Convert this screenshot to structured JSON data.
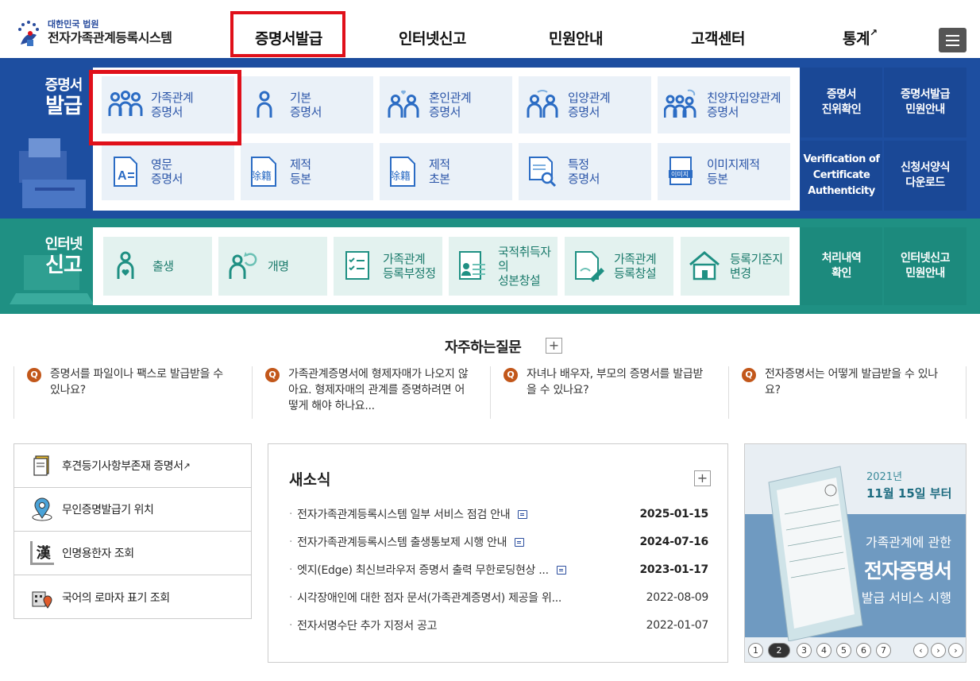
{
  "header": {
    "logo_line1": "대한민국 법원",
    "logo_line2": "전자가족관계등록시스템",
    "nav": [
      "증명서발급",
      "인터넷신고",
      "민원안내",
      "고객센터",
      "통계"
    ],
    "menu_icon": "hamburger-icon"
  },
  "cert": {
    "title_small": "증명서",
    "title_big": "발급",
    "tiles": [
      {
        "l1": "가족관계",
        "l2": "증명서",
        "icon": "family-icon"
      },
      {
        "l1": "기본",
        "l2": "증명서",
        "icon": "person-icon"
      },
      {
        "l1": "혼인관계",
        "l2": "증명서",
        "icon": "couple-heart-icon"
      },
      {
        "l1": "입양관계",
        "l2": "증명서",
        "icon": "adoption-icon"
      },
      {
        "l1": "친양자입양관계",
        "l2": "증명서",
        "icon": "full-adoption-icon"
      },
      {
        "l1": "영문",
        "l2": "증명서",
        "icon": "english-doc-icon"
      },
      {
        "l1": "제적",
        "l2": "등본",
        "icon": "removed-register-icon"
      },
      {
        "l1": "제적",
        "l2": "초본",
        "icon": "removed-register-icon"
      },
      {
        "l1": "특정",
        "l2": "증명서",
        "icon": "search-doc-icon"
      },
      {
        "l1": "이미지제적",
        "l2": "등본",
        "icon": "image-doc-icon"
      }
    ],
    "side": [
      {
        "l1": "증명서",
        "l2": "진위확인"
      },
      {
        "l1": "증명서발급",
        "l2": "민원안내"
      },
      {
        "l1": "Verification of",
        "l2": "Certificate",
        "l3": "Authenticity"
      },
      {
        "l1": "신청서양식",
        "l2": "다운로드"
      }
    ],
    "removed_badge": "除籍",
    "image_badge": "이미지"
  },
  "report": {
    "title_small": "인터넷",
    "title_big": "신고",
    "tiles": [
      {
        "l1": "출생",
        "l2": "",
        "icon": "birth-icon"
      },
      {
        "l1": "개명",
        "l2": "",
        "icon": "rename-icon"
      },
      {
        "l1": "가족관계",
        "l2": "등록부정정",
        "icon": "checklist-icon"
      },
      {
        "l1": "국적취득자의",
        "l2": "성본창설",
        "icon": "id-card-icon"
      },
      {
        "l1": "가족관계",
        "l2": "등록창설",
        "icon": "doc-pen-icon"
      },
      {
        "l1": "등록기준지",
        "l2": "변경",
        "icon": "house-icon"
      }
    ],
    "side": [
      {
        "l1": "처리내역",
        "l2": "확인"
      },
      {
        "l1": "인터넷신고",
        "l2": "민원안내"
      }
    ]
  },
  "faq": {
    "title": "자주하는질문",
    "plus": "+",
    "badge": "Q",
    "items": [
      "증명서를 파일이나 팩스로 발급받을 수 있나요?",
      "가족관계증명서에 형제자매가 나오지 않아요. 형제자매의 관계를 증명하려면 어떻게 해야 하나요...",
      "자녀나 배우자, 부모의 증명서를 발급받을 수 있나요?",
      "전자증명서는 어떻게 발급받을 수 있나요?"
    ]
  },
  "quick": [
    {
      "label": "후견등기사항부존재 증명서",
      "icon": "doc-icon",
      "ext": true
    },
    {
      "label": "무인증명발급기 위치",
      "icon": "location-icon",
      "ext": false
    },
    {
      "label": "인명용한자 조회",
      "icon": "hanja-book-icon",
      "ext": false
    },
    {
      "label": "국어의 로마자 표기 조회",
      "icon": "building-pin-icon",
      "ext": false
    }
  ],
  "quick_hanja": "漢",
  "news": {
    "title": "새소식",
    "plus": "+",
    "items": [
      {
        "title": "전자가족관계등록시스템 일부 서비스 점검 안내",
        "date": "2025-01-15",
        "new": true
      },
      {
        "title": "전자가족관계등록시스템 출생통보제 시행 안내",
        "date": "2024-07-16",
        "new": true
      },
      {
        "title": "엣지(Edge) 최신브라우저 증명서 출력 무한로딩현상 ...",
        "date": "2023-01-17",
        "new": true
      },
      {
        "title": "시각장애인에 대한 점자 문서(가족관계증명서) 제공을 위...",
        "date": "2022-08-09",
        "new": false
      },
      {
        "title": "전자서명수단 추가 지정서 공고",
        "date": "2022-01-07",
        "new": false
      }
    ]
  },
  "banner": {
    "year": "2021년",
    "date": "11월 15일 부터",
    "line1": "가족관계에 관한",
    "line2": "전자증명서",
    "line3": "발급 서비스 시행",
    "pages": [
      "1",
      "2",
      "3",
      "4",
      "5",
      "6",
      "7"
    ],
    "active_page": 2,
    "prev": "‹",
    "play": "›",
    "next": "›"
  },
  "colors": {
    "cert_band": "#1d4ea0",
    "report_band": "#1f9083",
    "highlight": "#e0101a"
  }
}
